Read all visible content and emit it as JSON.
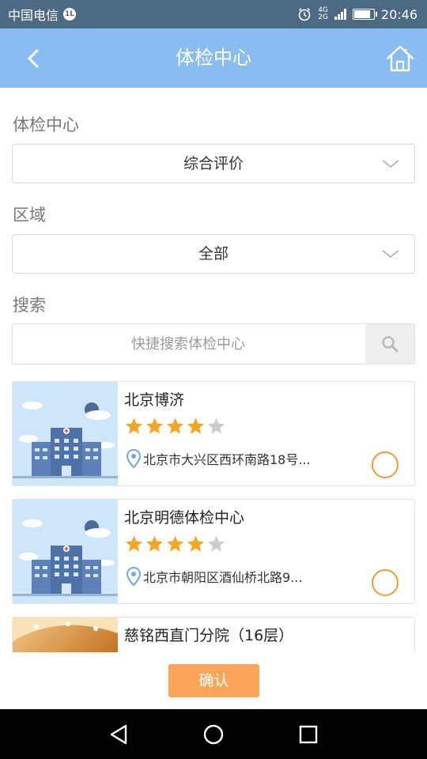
{
  "status_bar": {
    "carrier": "中国电信",
    "hd_badge": "1L",
    "network_top": "4G",
    "network_bottom": "2G",
    "time": "20:46"
  },
  "header": {
    "title": "体检中心",
    "back_icon": "chevron-left-icon",
    "home_icon": "home-icon"
  },
  "filters": {
    "center_label": "体检中心",
    "center_value": "综合评价",
    "region_label": "区域",
    "region_value": "全部",
    "search_label": "搜索",
    "search_placeholder": "快捷搜索体检中心",
    "search_value": ""
  },
  "centers": [
    {
      "name": "北京博济",
      "rating": 4,
      "max_rating": 5,
      "address": "北京市大兴区西环南路18号...",
      "selected": false
    },
    {
      "name": "北京明德体检中心",
      "rating": 4,
      "max_rating": 5,
      "address": "北京市朝阳区酒仙桥北路9...",
      "selected": false
    },
    {
      "name": "慈铭西直门分院（16层）"
    }
  ],
  "actions": {
    "confirm_label": "确认"
  },
  "colors": {
    "header": "#89bdf2",
    "status_bar": "#4d6a85",
    "accent": "#f39a2d",
    "confirm": "#fba55b",
    "star_on": "#f5a623",
    "star_off": "#cccccc"
  },
  "nav": {
    "back_icon": "triangle-back-icon",
    "home_icon": "circle-home-icon",
    "recents_icon": "square-recents-icon"
  }
}
